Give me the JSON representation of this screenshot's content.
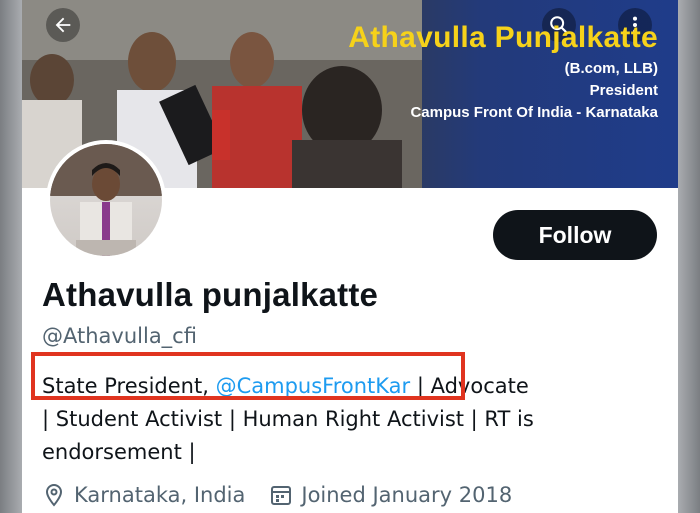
{
  "banner": {
    "name": "Athavulla Punjalkatte",
    "degree": "(B.com, LLB)",
    "role": "President",
    "org": "Campus Front Of India - Karnataka"
  },
  "nav": {
    "back_icon": "arrow-left-icon",
    "search_icon": "search-icon",
    "more_icon": "more-vertical-icon"
  },
  "profile": {
    "display_name": "Athavulla punjalkatte",
    "handle": "@Athavulla_cfi",
    "follow_label": "Follow",
    "bio": {
      "prefix": "State President, ",
      "mention": "@CampusFrontKar",
      "rest_line1": " | Advocate",
      "line2": "| Student Activist | Human Right Activist | RT is",
      "line3": "endorsement |"
    },
    "location": "Karnataka, India",
    "joined": "Joined January 2018"
  },
  "colors": {
    "accent": "#1d9bf0",
    "highlight": "#e0341f",
    "banner_title": "#f6d21a",
    "follow_bg": "#0f1419"
  }
}
